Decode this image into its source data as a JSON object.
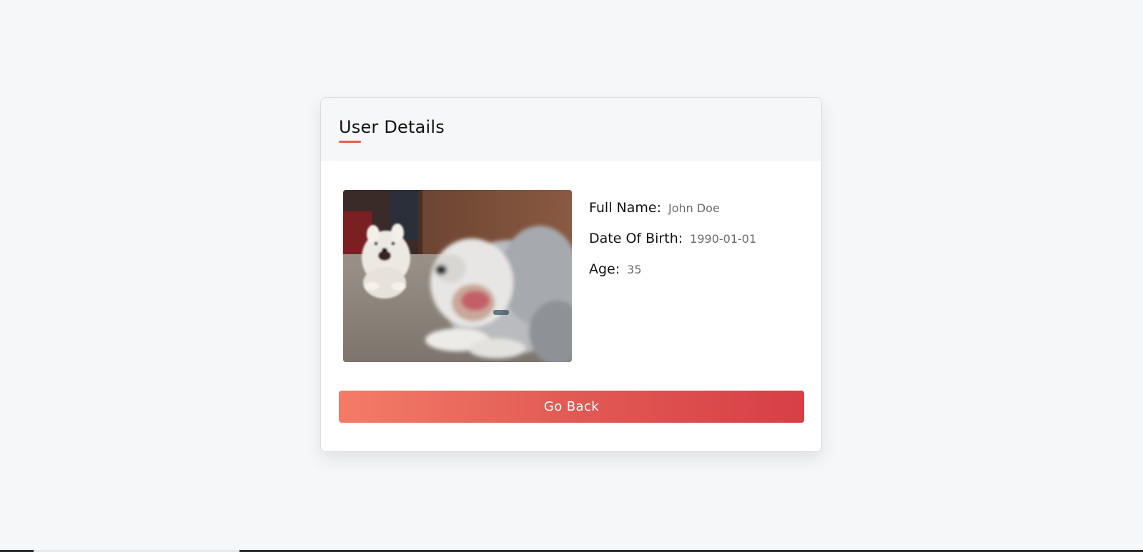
{
  "card": {
    "title": "User Details",
    "photo_alt": "Two dogs on a carpet"
  },
  "user": {
    "fields": [
      {
        "label": "Full Name:",
        "value": "John Doe"
      },
      {
        "label": "Date Of Birth:",
        "value": "1990-01-01"
      },
      {
        "label": "Age:",
        "value": "35"
      }
    ]
  },
  "actions": {
    "go_back_label": "Go Back"
  },
  "colors": {
    "accent": "#ea5b4e",
    "button_gradient_start": "#f47c67",
    "button_gradient_end": "#d73f45",
    "page_bg": "#f6f7f9"
  }
}
